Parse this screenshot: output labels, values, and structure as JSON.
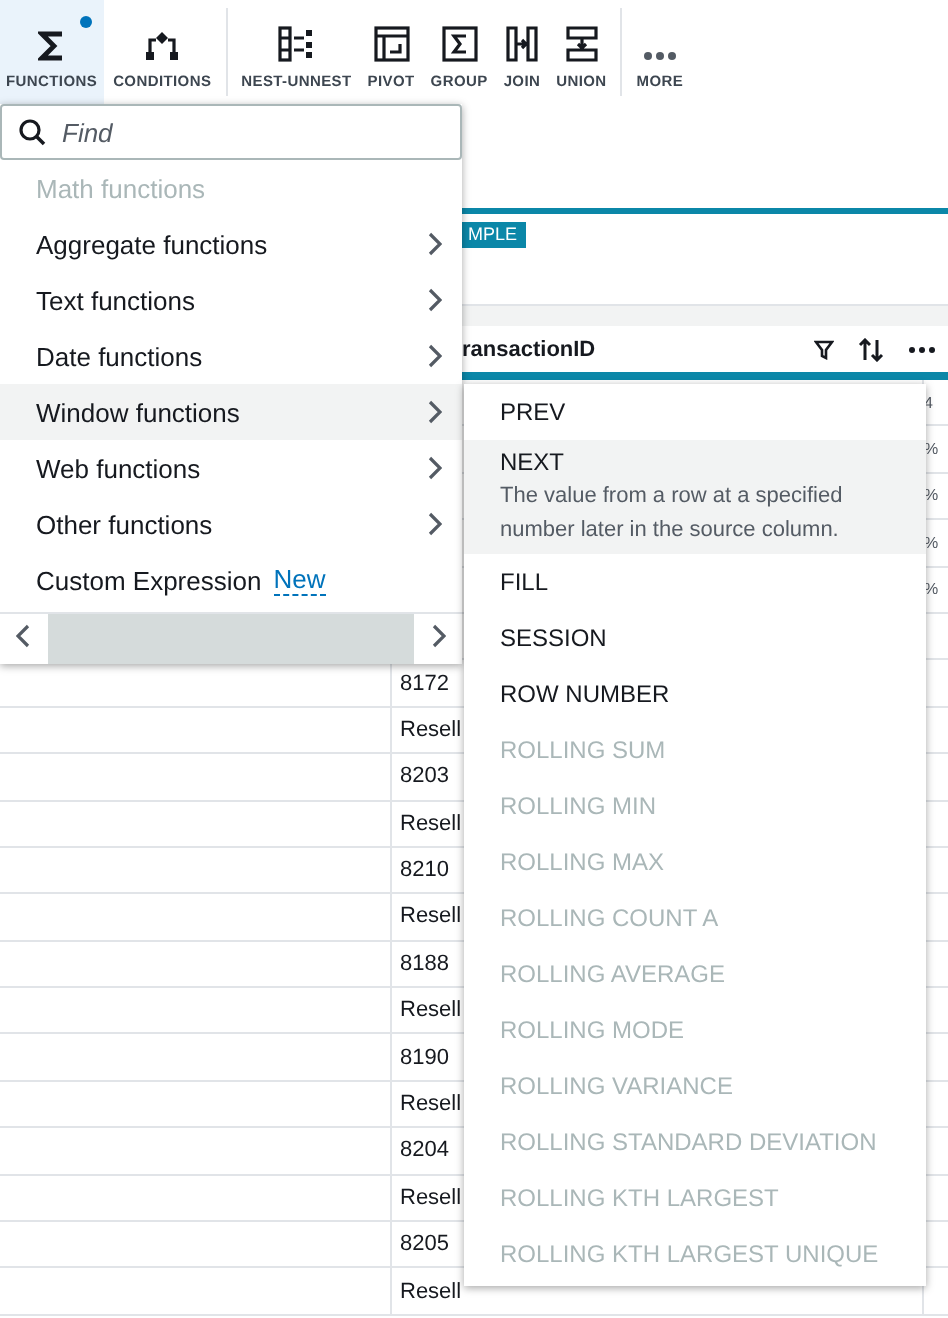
{
  "toolbar": {
    "groups": [
      [
        {
          "label": "FUNCTIONS",
          "selected": true,
          "dot": true
        },
        {
          "label": "CONDITIONS",
          "selected": false,
          "dot": false
        }
      ],
      [
        {
          "label": "NEST-UNNEST",
          "selected": false,
          "dot": false
        },
        {
          "label": "PIVOT",
          "selected": false,
          "dot": false
        },
        {
          "label": "GROUP",
          "selected": false,
          "dot": false
        },
        {
          "label": "JOIN",
          "selected": false,
          "dot": false
        },
        {
          "label": "UNION",
          "selected": false,
          "dot": false
        }
      ],
      [
        {
          "label": "MORE",
          "selected": false,
          "dot": false
        }
      ]
    ]
  },
  "tab_strip": {
    "tab": "MPLE"
  },
  "column_header": {
    "title": "ransactionID"
  },
  "table": {
    "rows": [
      {
        "col_3": "4"
      },
      {
        "col_3": "%"
      },
      {
        "col_3": "%"
      },
      {
        "col_3": "%"
      },
      {
        "col_3": "%"
      },
      {},
      {
        "col_2": "8172"
      },
      {
        "col_2": "Resell"
      },
      {
        "col_2": "8203"
      },
      {
        "col_2": "Resell"
      },
      {
        "col_2": "8210"
      },
      {
        "col_2": "Resell"
      },
      {
        "col_2": "8188"
      },
      {
        "col_2": "Resell"
      },
      {
        "col_2": "8190"
      },
      {
        "col_2": "Resell"
      },
      {
        "col_2": "8204"
      },
      {
        "col_2": "Resell"
      },
      {
        "col_2": "8205"
      },
      {
        "col_2": "Resell"
      }
    ]
  },
  "functions_menu": {
    "search": {
      "placeholder": "Find"
    },
    "items": [
      {
        "label": "Math functions",
        "disabled": true,
        "selected": false,
        "submenu": false
      },
      {
        "label": "Aggregate functions",
        "disabled": false,
        "selected": false,
        "submenu": true
      },
      {
        "label": "Text functions",
        "disabled": false,
        "selected": false,
        "submenu": true
      },
      {
        "label": "Date functions",
        "disabled": false,
        "selected": false,
        "submenu": true
      },
      {
        "label": "Window functions",
        "disabled": false,
        "selected": true,
        "submenu": true
      },
      {
        "label": "Web functions",
        "disabled": false,
        "selected": false,
        "submenu": true
      },
      {
        "label": "Other functions",
        "disabled": false,
        "selected": false,
        "submenu": true
      },
      {
        "label": "Custom Expression",
        "disabled": false,
        "selected": false,
        "submenu": false,
        "badge": "New"
      }
    ]
  },
  "window_functions_menu": {
    "items": [
      {
        "label": "PREV",
        "disabled": false,
        "selected": false
      },
      {
        "label": "NEXT",
        "disabled": false,
        "selected": true,
        "description": "The value from a row at a specified number later in the source column."
      },
      {
        "label": "FILL",
        "disabled": false,
        "selected": false
      },
      {
        "label": "SESSION",
        "disabled": false,
        "selected": false
      },
      {
        "label": "ROW NUMBER",
        "disabled": false,
        "selected": false
      },
      {
        "label": "ROLLING SUM",
        "disabled": true,
        "selected": false
      },
      {
        "label": "ROLLING MIN",
        "disabled": true,
        "selected": false
      },
      {
        "label": "ROLLING MAX",
        "disabled": true,
        "selected": false
      },
      {
        "label": "ROLLING COUNT A",
        "disabled": true,
        "selected": false
      },
      {
        "label": "ROLLING AVERAGE",
        "disabled": true,
        "selected": false
      },
      {
        "label": "ROLLING MODE",
        "disabled": true,
        "selected": false
      },
      {
        "label": "ROLLING VARIANCE",
        "disabled": true,
        "selected": false
      },
      {
        "label": "ROLLING STANDARD DEVIATION",
        "disabled": true,
        "selected": false
      },
      {
        "label": "ROLLING KTH LARGEST",
        "disabled": true,
        "selected": false
      },
      {
        "label": "ROLLING KTH LARGEST UNIQUE",
        "disabled": true,
        "selected": false
      }
    ]
  }
}
